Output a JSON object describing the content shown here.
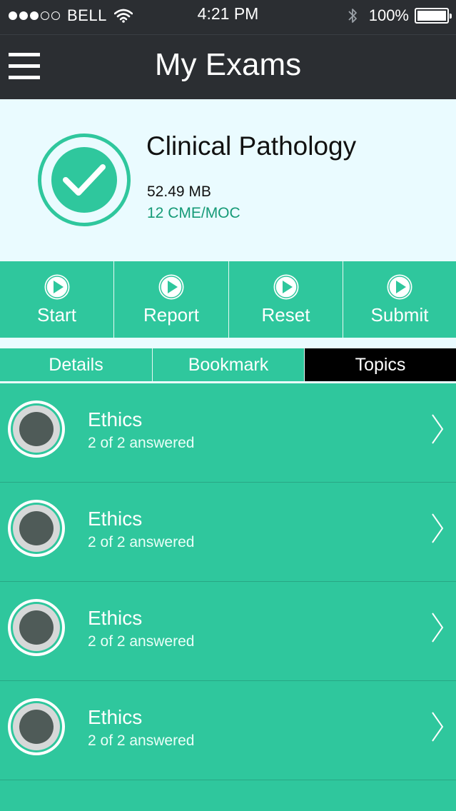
{
  "status_bar": {
    "carrier": "BELL",
    "time": "4:21 PM",
    "battery": "100%",
    "signal_dots_filled": 3,
    "signal_dots_total": 5
  },
  "header": {
    "title": "My Exams",
    "menu_icon": "hamburger-menu-icon"
  },
  "exam": {
    "name": "Clinical Pathology",
    "size": "52.49 MB",
    "credits": "12 CME/MOC",
    "status_icon": "checkmark-icon"
  },
  "actions": [
    {
      "label": "Start",
      "icon": "play-icon"
    },
    {
      "label": "Report",
      "icon": "play-icon"
    },
    {
      "label": "Reset",
      "icon": "play-icon"
    },
    {
      "label": "Submit",
      "icon": "play-icon"
    }
  ],
  "tabs": [
    {
      "label": "Details",
      "active": false
    },
    {
      "label": "Bookmark",
      "active": false
    },
    {
      "label": "Topics",
      "active": true
    }
  ],
  "topics": [
    {
      "name": "Ethics",
      "progress": "2 of 2 answered"
    },
    {
      "name": "Ethics",
      "progress": "2 of 2 answered"
    },
    {
      "name": "Ethics",
      "progress": "2 of 2 answered"
    },
    {
      "name": "Ethics",
      "progress": "2 of 2 answered"
    }
  ],
  "colors": {
    "accent": "#2fc79d",
    "header_bg": "#2b2e32",
    "panel_bg": "#eafbff",
    "credits_text": "#159a77",
    "active_tab": "#000000"
  }
}
